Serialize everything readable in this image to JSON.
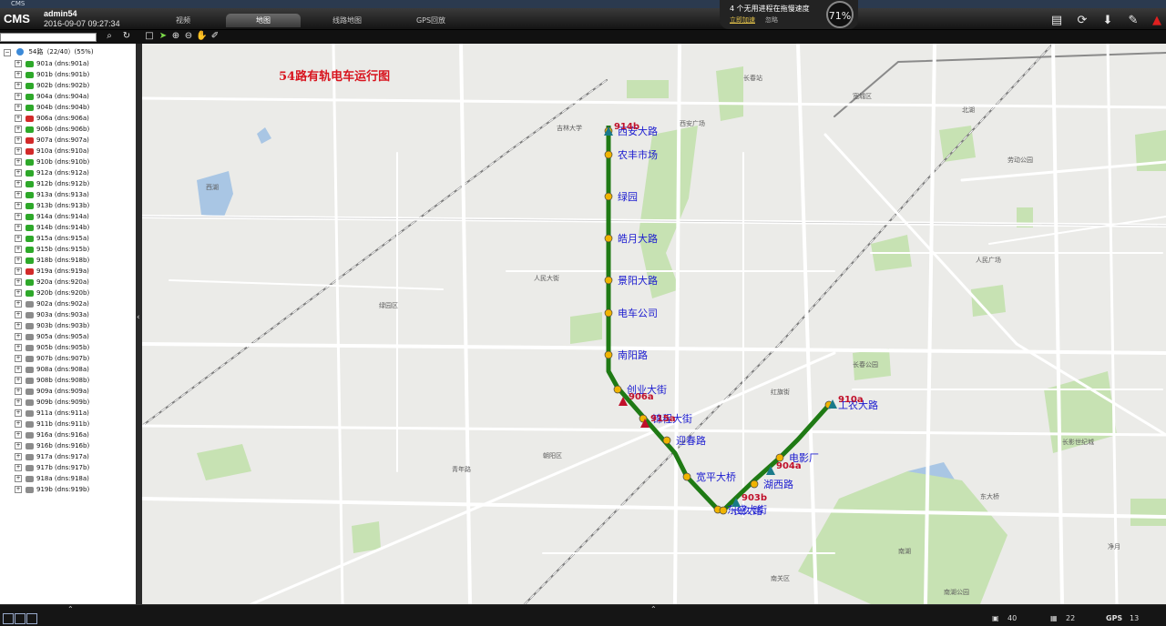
{
  "window": {
    "title": "CMS"
  },
  "header": {
    "logo": "CMS",
    "user": "admin54",
    "datetime": "2016-09-07 09:27:34",
    "tabs": [
      {
        "label": "视频",
        "active": false
      },
      {
        "label": "地图",
        "active": true
      },
      {
        "label": "线路地图",
        "active": false
      },
      {
        "label": "GPS回放",
        "active": false
      }
    ],
    "notice": {
      "text": "4 个无用进程在拖慢速度",
      "action": "立即加速",
      "ignore": "忽略"
    },
    "gauge": "71%"
  },
  "toolbar": {
    "search_placeholder": ""
  },
  "tree": {
    "root": "54路（22/40）(55%)",
    "items": [
      {
        "label": "901a (dns:901a)",
        "status": "online"
      },
      {
        "label": "901b (dns:901b)",
        "status": "online"
      },
      {
        "label": "902b (dns:902b)",
        "status": "online"
      },
      {
        "label": "904a (dns:904a)",
        "status": "online"
      },
      {
        "label": "904b (dns:904b)",
        "status": "online"
      },
      {
        "label": "906a (dns:906a)",
        "status": "alarm"
      },
      {
        "label": "906b (dns:906b)",
        "status": "online"
      },
      {
        "label": "907a (dns:907a)",
        "status": "alarm"
      },
      {
        "label": "910a (dns:910a)",
        "status": "alarm"
      },
      {
        "label": "910b (dns:910b)",
        "status": "online"
      },
      {
        "label": "912a (dns:912a)",
        "status": "online"
      },
      {
        "label": "912b (dns:912b)",
        "status": "online"
      },
      {
        "label": "913a (dns:913a)",
        "status": "online"
      },
      {
        "label": "913b (dns:913b)",
        "status": "online"
      },
      {
        "label": "914a (dns:914a)",
        "status": "online"
      },
      {
        "label": "914b (dns:914b)",
        "status": "online"
      },
      {
        "label": "915a (dns:915a)",
        "status": "online"
      },
      {
        "label": "915b (dns:915b)",
        "status": "online"
      },
      {
        "label": "918b (dns:918b)",
        "status": "online"
      },
      {
        "label": "919a (dns:919a)",
        "status": "alarm"
      },
      {
        "label": "920a (dns:920a)",
        "status": "online"
      },
      {
        "label": "920b (dns:920b)",
        "status": "online"
      },
      {
        "label": "902a (dns:902a)",
        "status": "offline"
      },
      {
        "label": "903a (dns:903a)",
        "status": "offline"
      },
      {
        "label": "903b (dns:903b)",
        "status": "offline"
      },
      {
        "label": "905a (dns:905a)",
        "status": "offline"
      },
      {
        "label": "905b (dns:905b)",
        "status": "offline"
      },
      {
        "label": "907b (dns:907b)",
        "status": "offline"
      },
      {
        "label": "908a (dns:908a)",
        "status": "offline"
      },
      {
        "label": "908b (dns:908b)",
        "status": "offline"
      },
      {
        "label": "909a (dns:909a)",
        "status": "offline"
      },
      {
        "label": "909b (dns:909b)",
        "status": "offline"
      },
      {
        "label": "911a (dns:911a)",
        "status": "offline"
      },
      {
        "label": "911b (dns:911b)",
        "status": "offline"
      },
      {
        "label": "916a (dns:916a)",
        "status": "offline"
      },
      {
        "label": "916b (dns:916b)",
        "status": "offline"
      },
      {
        "label": "917a (dns:917a)",
        "status": "offline"
      },
      {
        "label": "917b (dns:917b)",
        "status": "offline"
      },
      {
        "label": "918a (dns:918a)",
        "status": "offline"
      },
      {
        "label": "919b (dns:919b)",
        "status": "offline"
      }
    ]
  },
  "map": {
    "title": "54路有轨电车运行图",
    "stops": [
      "西安大路",
      "农丰市场",
      "绿园",
      "皓月大路",
      "景阳大路",
      "电车公司",
      "南阳路",
      "创业大街",
      "锦程大街",
      "迎春路",
      "宽平大桥",
      "东盛大街",
      "长久路",
      "湖西路",
      "电影厂",
      "工农大路"
    ],
    "vehicles": [
      "914b",
      "906a",
      "915a",
      "903b",
      "904a",
      "910a"
    ],
    "places": [
      "西安广场",
      "吉林大学",
      "南湖",
      "人民广场",
      "长春站",
      "长影世纪城",
      "净月",
      "绿园区",
      "朝阳区",
      "南关区",
      "宽城区",
      "北湖",
      "西湖",
      "长春公园",
      "南湖公园",
      "劳动公园",
      "青年路",
      "红旗街",
      "人民大街",
      "东大桥"
    ]
  },
  "status": {
    "printers": "40",
    "video": "22",
    "gps": "13",
    "gps_label": "GPS"
  },
  "colors": {
    "route": "#1f7a14",
    "stop": "#f0b400",
    "station_text": "#1b1bd0",
    "vehicle_text": "#c0102a",
    "title": "#d8141e"
  }
}
